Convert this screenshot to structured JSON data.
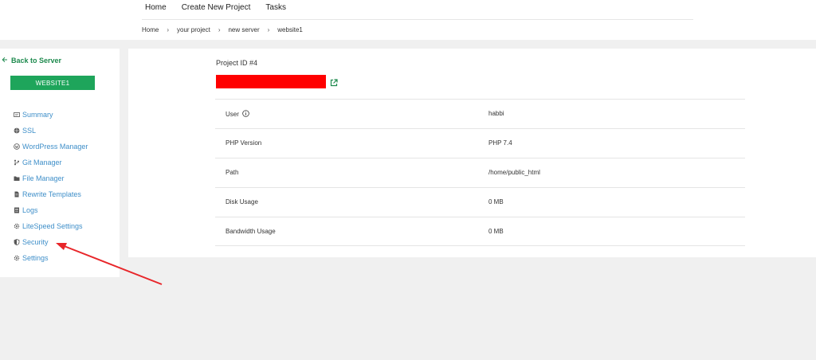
{
  "topnav": {
    "items": [
      "Home",
      "Create New Project",
      "Tasks"
    ]
  },
  "breadcrumb": {
    "items": [
      "Home",
      "your project",
      "new server",
      "website1"
    ],
    "separator": "›"
  },
  "sidebar": {
    "back_label": "Back to Server",
    "site_name": "WEBSITE1",
    "items": [
      {
        "label": "Summary",
        "icon": "summary-icon"
      },
      {
        "label": "SSL",
        "icon": "ssl-icon"
      },
      {
        "label": "WordPress Manager",
        "icon": "wordpress-icon"
      },
      {
        "label": "Git Manager",
        "icon": "git-icon"
      },
      {
        "label": "File Manager",
        "icon": "folder-icon"
      },
      {
        "label": "Rewrite Templates",
        "icon": "document-icon"
      },
      {
        "label": "Logs",
        "icon": "logs-icon"
      },
      {
        "label": "LiteSpeed Settings",
        "icon": "gear-icon"
      },
      {
        "label": "Security",
        "icon": "shield-icon"
      },
      {
        "label": "Settings",
        "icon": "gear-icon"
      }
    ]
  },
  "main": {
    "project_id_label": "Project ID #4",
    "rows": [
      {
        "label": "User",
        "value": "habbi"
      },
      {
        "label": "PHP Version",
        "value": "PHP 7.4"
      },
      {
        "label": "Path",
        "value": "/home/public_html"
      },
      {
        "label": "Disk Usage",
        "value": "0 MB"
      },
      {
        "label": "Bandwidth Usage",
        "value": "0 MB"
      }
    ]
  },
  "colors": {
    "accent_green": "#1ea55b",
    "link_blue": "#3f8fc9",
    "redaction": "#ff0000",
    "annotation_arrow": "#e8262a"
  }
}
